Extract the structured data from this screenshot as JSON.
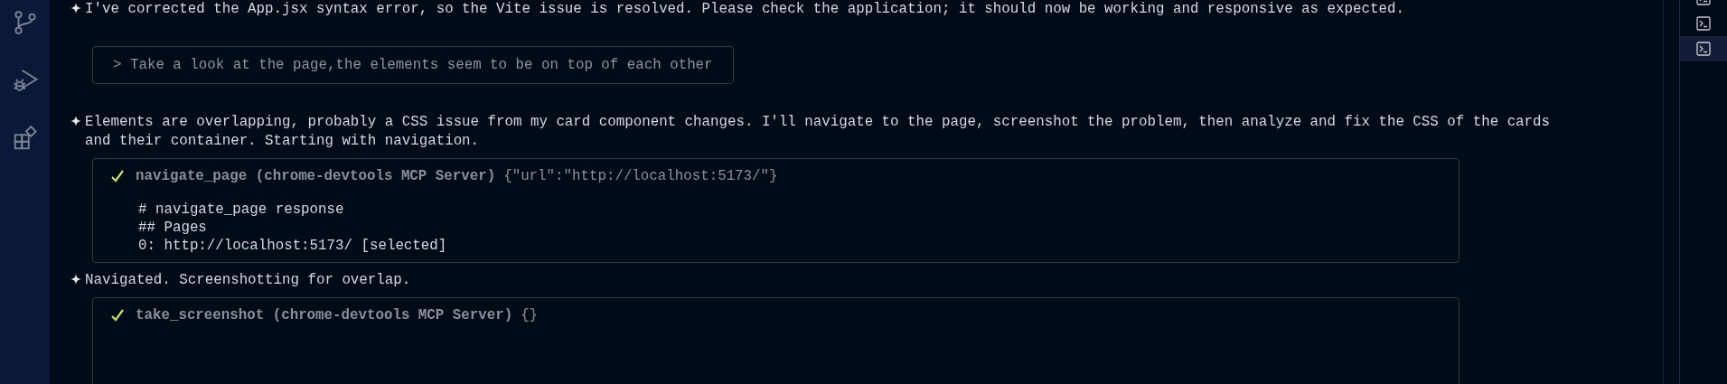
{
  "activity_bar": {
    "items": [
      {
        "kind": "source-control",
        "selected": false
      },
      {
        "kind": "run-debug",
        "selected": false
      },
      {
        "kind": "extensions",
        "selected": false
      }
    ]
  },
  "chat": {
    "messages": [
      {
        "kind": "assistant",
        "text": "I've corrected the App.jsx syntax error, so the Vite issue is resolved. Please check the application; it should now be working and responsive as expected."
      },
      {
        "kind": "user",
        "text": "> Take a look at the page,the elements seem to be on top of each other"
      },
      {
        "kind": "assistant",
        "text": "Elements are overlapping, probably a CSS issue from my card component changes. I'll navigate to the page, screenshot the problem, then analyze and fix the CSS of the cards and their container. Starting with navigation."
      },
      {
        "kind": "tool",
        "done": true,
        "name": "navigate_page",
        "server": "(chrome-devtools MCP Server)",
        "args": "{\"url\":\"http://localhost:5173/\"}",
        "output": [
          "# navigate_page response",
          "## Pages",
          "0: http://localhost:5173/ [selected]"
        ]
      },
      {
        "kind": "assistant",
        "text": "Navigated. Screenshotting for overlap."
      },
      {
        "kind": "tool",
        "done": true,
        "name": "take_screenshot",
        "server": "(chrome-devtools MCP Server)",
        "args": "{}"
      }
    ]
  },
  "terminal_panel": {
    "terminals": [
      {
        "selected": false
      },
      {
        "selected": false
      },
      {
        "selected": true
      }
    ]
  }
}
